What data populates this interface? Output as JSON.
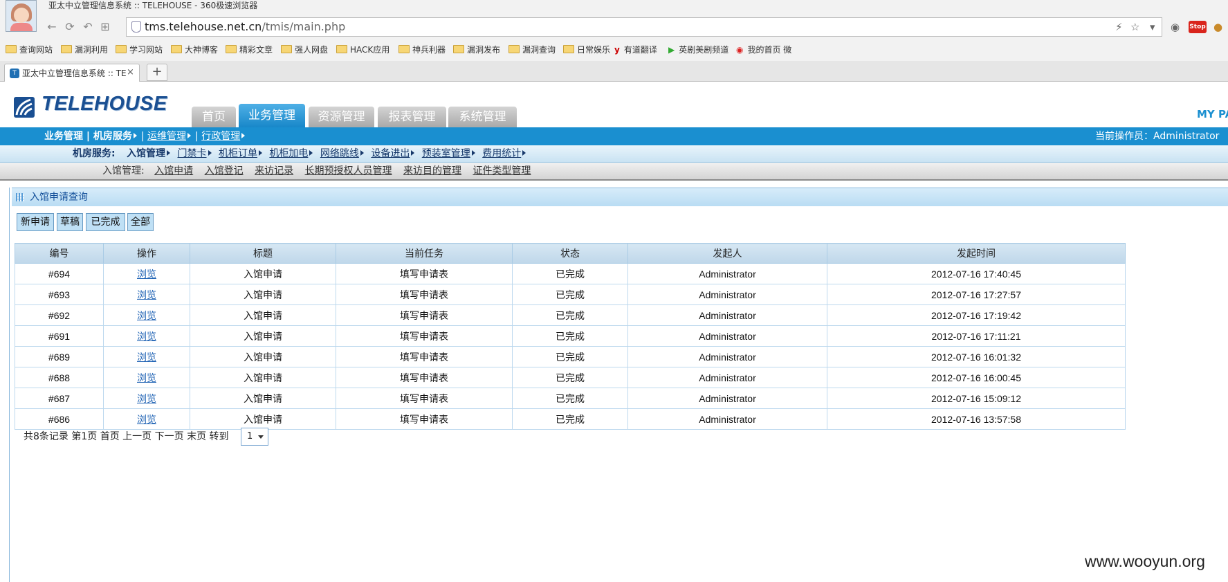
{
  "browser": {
    "window_title": "亚太中立管理信息系统 :: TELEHOUSE - 360极速浏览器",
    "url_host": "tms.telehouse.net.cn",
    "url_path": "/tmis/main.php",
    "bookmarks": [
      "查询网站",
      "漏洞利用",
      "学习网站",
      "大神博客",
      "精彩文章",
      "强人网盘",
      "HACK应用",
      "神兵利器",
      "漏洞发布",
      "漏洞查询",
      "日常娱乐",
      "有道翻译",
      "英剧美剧频道",
      "我的首页 微"
    ],
    "tab_title": "亚太中立管理信息系统 :: TE",
    "newtab_label": "+",
    "tab_close": "×"
  },
  "app": {
    "logo": "TELEHOUSE",
    "main_tabs": [
      "首页",
      "业务管理",
      "资源管理",
      "报表管理",
      "系统管理"
    ],
    "active_tab_index": 1,
    "my_page": "MY PA",
    "nav1": {
      "part1": "业务管理 | 机房服务",
      "link1": "运维管理",
      "link2": "行政管理",
      "sep": "|",
      "operator_label": "当前操作员：",
      "operator": "Administrator"
    },
    "nav2": {
      "label": "机房服务:",
      "items": [
        "入馆管理",
        "门禁卡",
        "机柜订单",
        "机柜加电",
        "网络跳线",
        "设备进出",
        "预装室管理",
        "费用统计"
      ]
    },
    "nav3": {
      "label": "入馆管理:",
      "items": [
        "入馆申请",
        "入馆登记",
        "来访记录",
        "长期预授权人员管理",
        "来访目的管理",
        "证件类型管理"
      ]
    },
    "panel_title": "入馆申请查询",
    "filters": [
      "新申请",
      "草稿",
      "已完成",
      "全部"
    ],
    "table": {
      "headers": [
        "编号",
        "操作",
        "标题",
        "当前任务",
        "状态",
        "发起人",
        "发起时间"
      ],
      "rows": [
        [
          "#694",
          "浏览",
          "入馆申请",
          "填写申请表",
          "已完成",
          "Administrator",
          "2012-07-16 17:40:45"
        ],
        [
          "#693",
          "浏览",
          "入馆申请",
          "填写申请表",
          "已完成",
          "Administrator",
          "2012-07-16 17:27:57"
        ],
        [
          "#692",
          "浏览",
          "入馆申请",
          "填写申请表",
          "已完成",
          "Administrator",
          "2012-07-16 17:19:42"
        ],
        [
          "#691",
          "浏览",
          "入馆申请",
          "填写申请表",
          "已完成",
          "Administrator",
          "2012-07-16 17:11:21"
        ],
        [
          "#689",
          "浏览",
          "入馆申请",
          "填写申请表",
          "已完成",
          "Administrator",
          "2012-07-16 16:01:32"
        ],
        [
          "#688",
          "浏览",
          "入馆申请",
          "填写申请表",
          "已完成",
          "Administrator",
          "2012-07-16 16:00:45"
        ],
        [
          "#687",
          "浏览",
          "入馆申请",
          "填写申请表",
          "已完成",
          "Administrator",
          "2012-07-16 15:09:12"
        ],
        [
          "#686",
          "浏览",
          "入馆申请",
          "填写申请表",
          "已完成",
          "Administrator",
          "2012-07-16 13:57:58"
        ]
      ]
    },
    "pager": {
      "text": "共8条记录 第1页 首页 上一页 下一页 末页 转到",
      "page_value": "1"
    }
  },
  "watermark": "www.wooyun.org",
  "colors": {
    "accent": "#1a8fd0",
    "brand": "#1a4f92",
    "link": "#2466b6"
  }
}
